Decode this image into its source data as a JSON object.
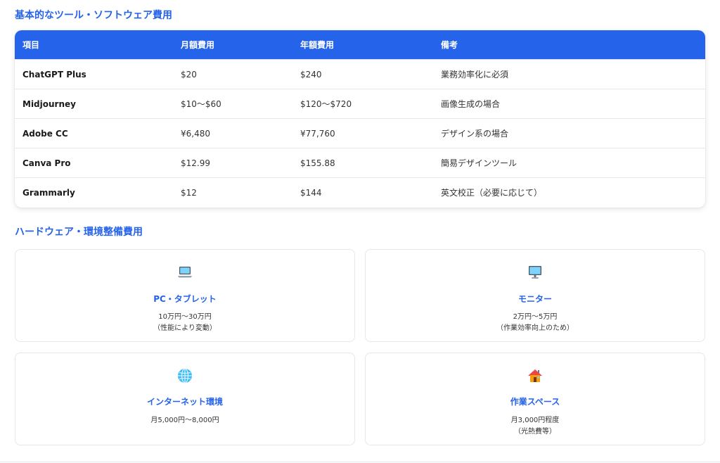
{
  "sections": {
    "software_title": "基本的なツール・ソフトウェア費用",
    "hardware_title": "ハードウェア・環境整備費用"
  },
  "table": {
    "headers": [
      "項目",
      "月額費用",
      "年額費用",
      "備考"
    ],
    "rows": [
      [
        "ChatGPT Plus",
        "$20",
        "$240",
        "業務効率化に必須"
      ],
      [
        "Midjourney",
        "$10〜$60",
        "$120〜$720",
        "画像生成の場合"
      ],
      [
        "Adobe CC",
        "¥6,480",
        "¥77,760",
        "デザイン系の場合"
      ],
      [
        "Canva Pro",
        "$12.99",
        "$155.88",
        "簡易デザインツール"
      ],
      [
        "Grammarly",
        "$12",
        "$144",
        "英文校正（必要に応じて）"
      ]
    ]
  },
  "cards": {
    "pc": {
      "icon": "laptop-icon",
      "title": "PC・タブレット",
      "line1": "10万円〜30万円",
      "line2": "（性能により変動）"
    },
    "monitor": {
      "icon": "monitor-icon",
      "title": "モニター",
      "line1": "2万円〜5万円",
      "line2": "（作業効率向上のため）"
    },
    "internet": {
      "icon": "globe-icon",
      "title": "インターネット環境",
      "line1": "月5,000円〜8,000円"
    },
    "space": {
      "icon": "house-icon",
      "title": "作業スペース",
      "line1": "月3,000円程度",
      "line2": "（光熱費等）"
    }
  },
  "colors": {
    "accent": "#2563eb",
    "border": "#e5e7eb"
  }
}
